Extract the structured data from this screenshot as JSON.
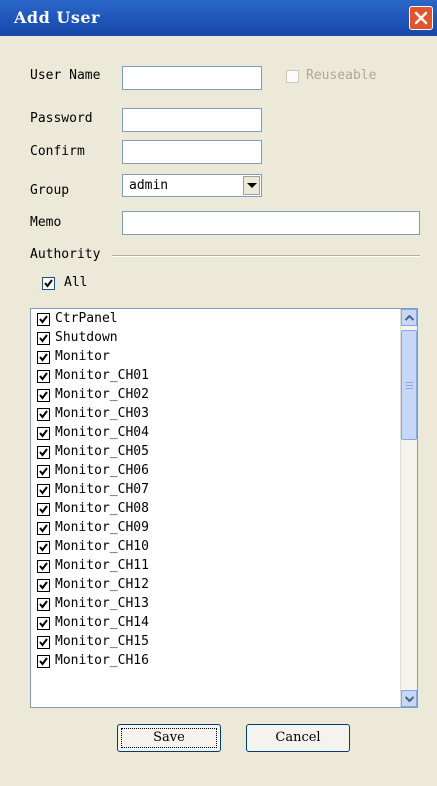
{
  "window": {
    "title": "Add User"
  },
  "form": {
    "user_name_label": "User Name",
    "user_name_value": "",
    "reuseable_label": "Reuseable",
    "password_label": "Password",
    "confirm_label": "Confirm",
    "group_label": "Group",
    "group_value": "admin",
    "memo_label": "Memo"
  },
  "authority": {
    "label": "Authority",
    "all_label": "All",
    "all_checked": true,
    "items": [
      "CtrPanel",
      "Shutdown",
      "Monitor",
      "Monitor_CH01",
      "Monitor_CH02",
      "Monitor_CH03",
      "Monitor_CH04",
      "Monitor_CH05",
      "Monitor_CH06",
      "Monitor_CH07",
      "Monitor_CH08",
      "Monitor_CH09",
      "Monitor_CH10",
      "Monitor_CH11",
      "Monitor_CH12",
      "Monitor_CH13",
      "Monitor_CH14",
      "Monitor_CH15",
      "Monitor_CH16"
    ]
  },
  "buttons": {
    "save": "Save",
    "cancel": "Cancel"
  },
  "icons": {
    "close": "close-icon",
    "dropdown": "chevron-down-icon",
    "scroll_up": "chevron-up-icon",
    "scroll_down": "chevron-down-icon",
    "check": "checkmark-icon"
  },
  "colors": {
    "titlebar": "#1f55b8",
    "close": "#e2542c",
    "window_bg": "#ece9d8"
  }
}
